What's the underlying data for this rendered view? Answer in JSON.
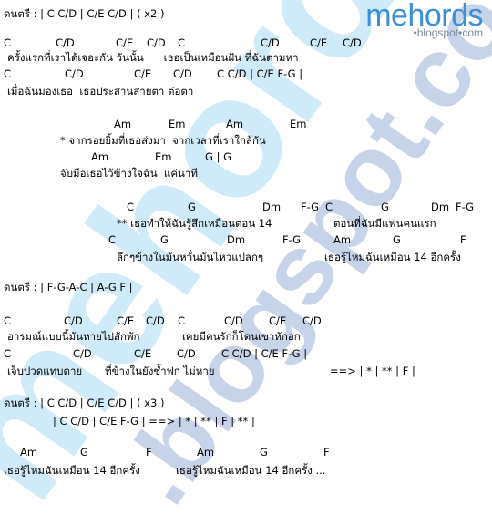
{
  "logo": {
    "name": "mehords",
    "sub": "•blogspot•com"
  },
  "watermark": {
    "text": "mehords",
    "sub": ".blogspot.com",
    "color_main": "#cfeaf9",
    "color_sub": "#c6d3e8"
  },
  "sheet": {
    "intro1": "ดนตรี : | C C/D | C/E C/D | ( x2 )",
    "verse1": {
      "chords1": [
        "C",
        "C/D",
        "C/E",
        "C/D",
        "C",
        "C/D",
        "C/E",
        "C/D"
      ],
      "lyric1": "ครั้งแรกที่เราได้เจอะกัน วันนั้น      เธอเป็นเหมือนฝัน ที่ฉันตามหา",
      "chords2": [
        "C",
        "C/D",
        "C/E",
        "C/D",
        "C C/D | C/E F-G |"
      ],
      "lyric2": "เมื่อฉันมองเธอ  เธอประสานสายตา ต่อตา"
    },
    "pre_chorus": {
      "chords1": [
        "Am",
        "Em",
        "Am",
        "Em"
      ],
      "lyric1": "* จากรอยยิ้มที่เธอส่งมา  จากเวลาที่เราใกล้กัน",
      "chords2": [
        "Am",
        "Em",
        "G | G"
      ],
      "lyric2": "จับมือเธอไว้ข้างใจฉัน  แค่นาที"
    },
    "chorus": {
      "chords1": [
        "C",
        "G",
        "Dm",
        "F-G",
        "C",
        "G",
        "Dm",
        "F-G"
      ],
      "lyric1a": "** เธอทำให้ฉันรู้สึกเหมือนตอน 14",
      "lyric1b": "ตอนที่ฉันมีแฟนคนแรก",
      "chords2": [
        "C",
        "G",
        "Dm",
        "F-G",
        "Am",
        "G",
        "F"
      ],
      "lyric2a": "ลึกๆข้างในมันหวั่นมันไหวแปลกๆ",
      "lyric2b": "เธอรู้ไหมฉันเหมือน 14 อีกครั้ง"
    },
    "intro2": "ดนตรี : | F-G-A-C | A-G F |",
    "verse2": {
      "chords1": [
        "C",
        "C/D",
        "C/E",
        "C/D",
        "C",
        "C/D",
        "C/E",
        "C/D"
      ],
      "lyric1a": "อารมณ์แบบนี้มันหายไปสักพัก",
      "lyric1b": "เคยมีคนรักก็โดนเขาหักอก",
      "chords2": [
        "C",
        "C/D",
        "C/E",
        "C/D",
        "C C/D | C/E F-G |"
      ],
      "lyric2a": "เจ็บปวดแทบตาย",
      "lyric2b": "ที่ข้างในยังช้ำฟก ไม่หาย",
      "repeat": "==> | * | ** | F |"
    },
    "intro3": "ดนตรี : | C C/D | C/E C/D | ( x3 )",
    "intro3b": "| C C/D | C/E F-G | ==> | * | ** | F | ** |",
    "outro": {
      "chords": [
        "Am",
        "G",
        "F",
        "Am",
        "G",
        "F"
      ],
      "lyric_a": "เธอรู้ไหมฉันเหมือน 14 อีกครั้ง",
      "lyric_b": "เธอรู้ไหมฉันเหมือน 14 อีกครั้ง ..."
    }
  }
}
